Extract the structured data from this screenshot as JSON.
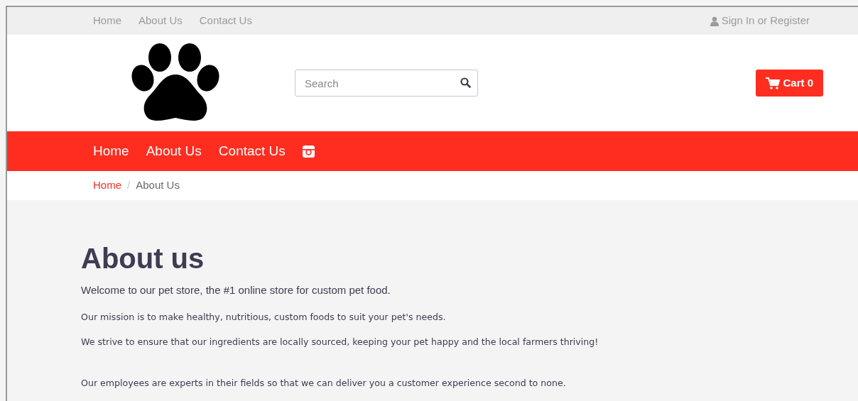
{
  "top_nav": {
    "links": [
      "Home",
      "About Us",
      "Contact Us"
    ],
    "account": "Sign In or Register"
  },
  "header": {
    "search": {
      "placeholder": "Search"
    },
    "cart": "Cart 0"
  },
  "main_nav": {
    "links": [
      "Home",
      "About Us",
      "Contact Us"
    ]
  },
  "breadcrumb": {
    "separator": "/",
    "items": [
      {
        "label": "Home",
        "selected": false
      },
      {
        "label": "About Us",
        "selected": true
      }
    ]
  },
  "content": {
    "heading": "About us",
    "paragraphs": [
      {
        "kind": "intro",
        "text": "Welcome to our pet store, the #1 online store for custom pet food."
      },
      {
        "kind": "body",
        "text": "Our mission is to make healthy, nutritious, custom foods to suit your pet's needs."
      },
      {
        "kind": "body",
        "text": "We strive to ensure that our ingredients are locally sourced, keeping your pet happy and the local farmers thriving!"
      },
      {
        "kind": "gap"
      },
      {
        "kind": "body",
        "text": "Our employees are experts in their fields so that we can deliver you a customer experience second to none."
      }
    ]
  }
}
